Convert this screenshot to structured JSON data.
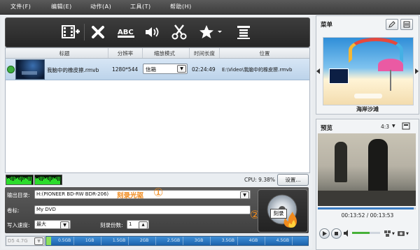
{
  "menu": [
    "文件(F)",
    "编辑(E)",
    "动作(A)",
    "工具(T)",
    "帮助(H)"
  ],
  "table": {
    "headers": [
      "标题",
      "分辨率",
      "缩放模式",
      "时间长度",
      "位置"
    ],
    "row": {
      "title": "我脑中的橡皮擦.rmvb",
      "resolution": "1280*544",
      "zoom_mode": "信箱",
      "duration": "02:24:49",
      "location": "E:\\Video\\我脑中的橡皮擦.rmvb"
    }
  },
  "status": {
    "cpu": "CPU: 9.38%",
    "settings_label": "设置..."
  },
  "output": {
    "dir_label": "输出目录:",
    "dir_value": "H:(PIONEER BD-RW   BDR-206)",
    "annotation": "刻录光驱",
    "marker1": "①",
    "marker2": "②",
    "volume_label": "卷标:",
    "volume_value": "My DVD",
    "speed_label": "写入速度:",
    "speed_value": "最大",
    "copies_label": "刻录份数:",
    "copies_value": "1"
  },
  "burn_button": {
    "label": "刻录"
  },
  "sizebar": {
    "disc": "D5 4.7G",
    "ticks": [
      "0.5GB",
      "1GB",
      "1.5GB",
      "2GB",
      "2.5GB",
      "3GB",
      "3.5GB",
      "4GB",
      "4.5GB"
    ],
    "used_fraction": 0.02
  },
  "menu_panel": {
    "title": "菜单",
    "caption": "海岸沙滩"
  },
  "preview": {
    "title": "预览",
    "aspect": "4:3",
    "time": "00:13:52 / 00:13:53",
    "progress": 0.98,
    "volume": 0.62
  },
  "colors": {
    "accent": "#f08a1c",
    "selection": "#c9dcef",
    "toolbar": "#2e2e2e"
  }
}
